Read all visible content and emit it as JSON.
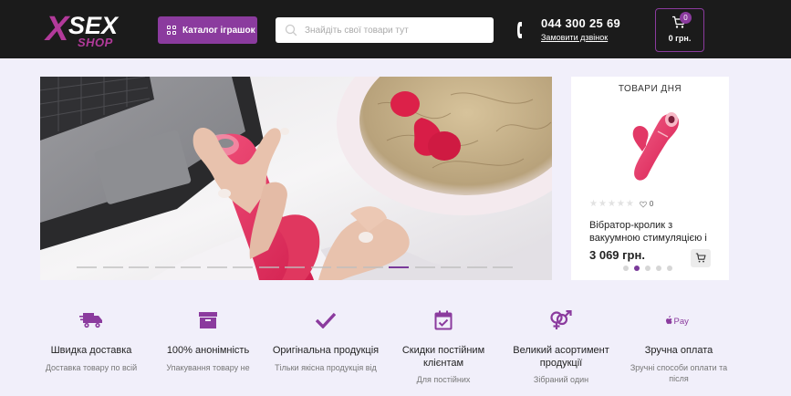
{
  "header": {
    "logo": {
      "x": "X",
      "sex": "SEX",
      "shop": "SHOP"
    },
    "catalog_label": "Каталог іграшок",
    "search_placeholder": "Знайдіть свої товари тут",
    "phone": "044 300 25 69",
    "callback_label": "Замовити дзвінок",
    "cart_count": "0",
    "cart_total": "0 грн."
  },
  "hero": {
    "slides_count": 17,
    "active_slide": 12
  },
  "product_of_day": {
    "title": "ТОВАРИ ДНЯ",
    "rating": 0,
    "reviews": "0",
    "name": "Вібратор-кролик з вакуумною стимуляцією і",
    "price": "3 069 грн.",
    "dots": 5,
    "active_dot": 1
  },
  "features": [
    {
      "icon": "truck-icon",
      "title": "Швидка доставка",
      "desc": "Доставка товару по всій"
    },
    {
      "icon": "package-icon",
      "title": "100% анонімність",
      "desc": "Упакування товару не"
    },
    {
      "icon": "checkmark-icon",
      "title": "Оригінальна продукція",
      "desc": "Тільки якісна продукція від"
    },
    {
      "icon": "calendar-check-icon",
      "title": "Скидки постійним клієнтам",
      "desc": "Для постійних"
    },
    {
      "icon": "gender-icon",
      "title": "Великий асортимент продукції",
      "desc": "Зібраний один"
    },
    {
      "icon": "apple-pay-icon",
      "title": "Зручна оплата",
      "desc": "Зручні способи оплати та після"
    }
  ],
  "colors": {
    "accent": "#8b3b9e",
    "header_bg": "#1b1b1b",
    "page_bg": "#f1effa"
  }
}
